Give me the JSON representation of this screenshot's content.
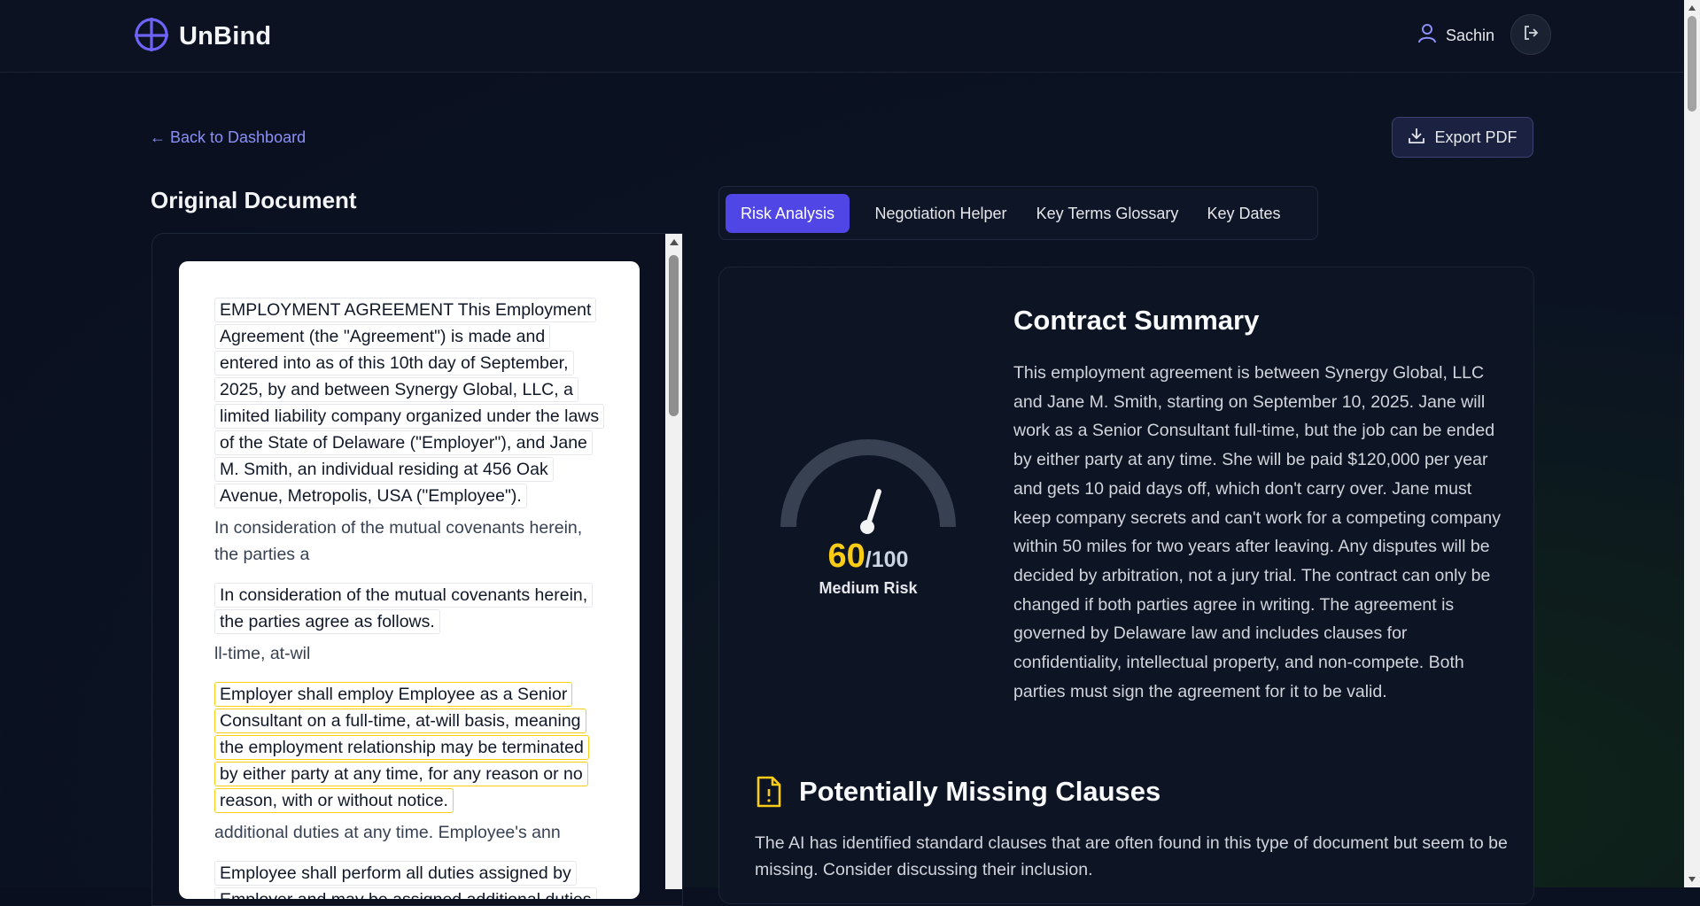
{
  "header": {
    "app_name": "UnBind",
    "user_name": "Sachin"
  },
  "nav": {
    "back_label": "← Back to Dashboard",
    "export_label": "Export PDF"
  },
  "document": {
    "title": "Original Document",
    "segments": [
      {
        "text": "EMPLOYMENT AGREEMENT This Employment Agreement (the \"Agreement\") is made and entered into as of this 10th day of September, 2025, by and between Synergy Global, LLC, a limited liability company organized under the laws of the State of Delaware (\"Employer\"), and Jane M. Smith, an individual residing at 456 Oak Avenue, Metropolis, USA (\"Employee\").",
        "highlight": false,
        "trailing": "In consideration of the mutual covenants herein, the parties a"
      },
      {
        "text": "In consideration of the mutual covenants herein, the parties agree as follows.",
        "highlight": false,
        "trailing": "ll-time, at-wil"
      },
      {
        "text": "Employer shall employ Employee as a Senior Consultant on a full-time, at-will basis, meaning the employment relationship may be terminated by either party at any time, for any reason or no reason, with or without notice.",
        "highlight": true,
        "trailing": "additional duties at any time. Employee's ann"
      },
      {
        "text": "Employee shall perform all duties assigned by Employer and may be assigned additional duties at any time.",
        "highlight": false,
        "trailing": ""
      }
    ]
  },
  "tabs": [
    {
      "label": "Risk Analysis",
      "active": true
    },
    {
      "label": "Negotiation Helper",
      "active": false
    },
    {
      "label": "Key Terms Glossary",
      "active": false
    },
    {
      "label": "Key Dates",
      "active": false
    }
  ],
  "risk": {
    "score": "60",
    "max": "/100",
    "label": "Medium Risk",
    "score_value": 60,
    "accent_color": "#facc15"
  },
  "summary": {
    "title": "Contract Summary",
    "text": "This employment agreement is between Synergy Global, LLC and Jane M. Smith, starting on September 10, 2025. Jane will work as a Senior Consultant full-time, but the job can be ended by either party at any time. She will be paid $120,000 per year and gets 10 paid days off, which don't carry over. Jane must keep company secrets and can't work for a competing company within 50 miles for two years after leaving. Any disputes will be decided by arbitration, not a jury trial. The contract can only be changed if both parties agree in writing. The agreement is governed by Delaware law and includes clauses for confidentiality, intellectual property, and non-compete. Both parties must sign the agreement for it to be valid."
  },
  "missing": {
    "title": "Potentially Missing Clauses",
    "text": "The AI has identified standard clauses that are often found in this type of document but seem to be missing. Consider discussing their inclusion."
  },
  "icons": {
    "logo": "globe-logo-icon",
    "user": "user-icon",
    "logout": "logout-icon",
    "download": "download-icon",
    "missing": "file-warning-icon"
  },
  "colors": {
    "brand": "#6d63f6",
    "active_tab": "#5046e5",
    "link": "#8b8ff8",
    "warning": "#facc15"
  }
}
